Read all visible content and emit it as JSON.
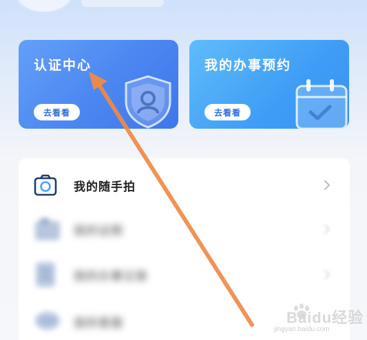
{
  "cards": [
    {
      "title": "认证中心",
      "button": "去看看",
      "icon": "shield-user-icon"
    },
    {
      "title": "我的办事预约",
      "button": "去看看",
      "icon": "calendar-check-icon"
    }
  ],
  "list": {
    "items": [
      {
        "label": "我的随手拍",
        "icon": "camera-icon",
        "blurred": false
      },
      {
        "label": "我的证照",
        "icon": "folder-icon",
        "blurred": true
      },
      {
        "label": "我的办事记录",
        "icon": "document-icon",
        "blurred": true
      },
      {
        "label": "我的客服",
        "icon": "chat-icon",
        "blurred": true
      }
    ]
  },
  "watermark": {
    "brand": "Baidu",
    "suffix": "经验",
    "url": "jingyan.baidu.com"
  },
  "colors": {
    "card_auth": "#4b86f1",
    "card_appt": "#3f9df6",
    "arrow": "#f08a46",
    "icon_navy": "#1d3d6e"
  }
}
